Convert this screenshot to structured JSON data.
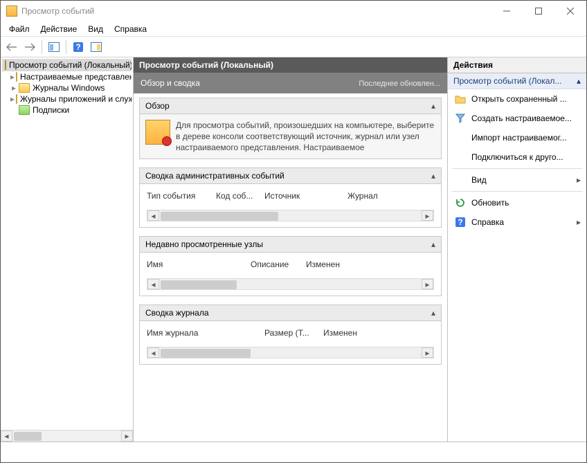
{
  "window": {
    "title": "Просмотр событий"
  },
  "menu": {
    "file": "Файл",
    "action": "Действие",
    "view": "Вид",
    "help": "Справка"
  },
  "tree": {
    "root": "Просмотр событий (Локальный)",
    "items": [
      "Настраиваемые представления",
      "Журналы Windows",
      "Журналы приложений и служб",
      "Подписки"
    ]
  },
  "center": {
    "title": "Просмотр событий (Локальный)",
    "overview_title": "Обзор и сводка",
    "last_update": "Последнее обновлен...",
    "sections": {
      "overview": {
        "head": "Обзор",
        "text": "Для просмотра событий, произошедших на компьютере, выберите в дереве консоли соответствующий источник, журнал или узел настраиваемого представления. Настраиваемое"
      },
      "admin": {
        "head": "Сводка административных событий",
        "cols": [
          "Тип события",
          "Код соб...",
          "Источник",
          "Журнал"
        ]
      },
      "recent": {
        "head": "Недавно просмотренные узлы",
        "cols": [
          "Имя",
          "Описание",
          "Изменен"
        ]
      },
      "log": {
        "head": "Сводка журнала",
        "cols": [
          "Имя журнала",
          "Размер (Т...",
          "Изменен"
        ]
      }
    }
  },
  "actions": {
    "title": "Действия",
    "group": "Просмотр событий (Локал...",
    "items": [
      "Открыть сохраненный ...",
      "Создать настраиваемое...",
      "Импорт настраиваемог...",
      "Подключиться к друго...",
      "Вид",
      "Обновить",
      "Справка"
    ]
  }
}
